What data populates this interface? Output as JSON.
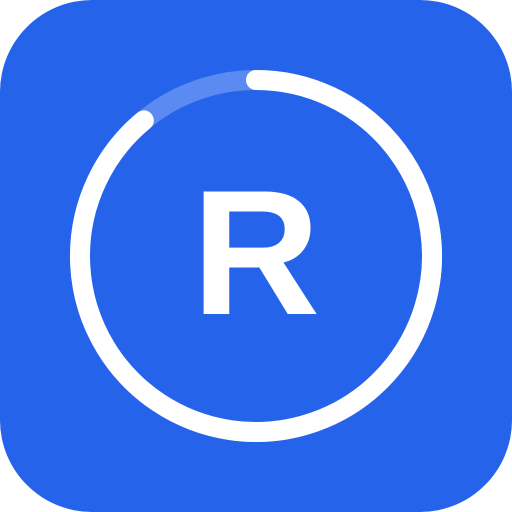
{
  "icon": {
    "letter": "R",
    "colors": {
      "background": "#2563EB",
      "ring": "#FFFFFF",
      "ring_faded": "#5B8AF2",
      "letter": "#FFFFFF"
    },
    "ring_progress": 0.89
  }
}
